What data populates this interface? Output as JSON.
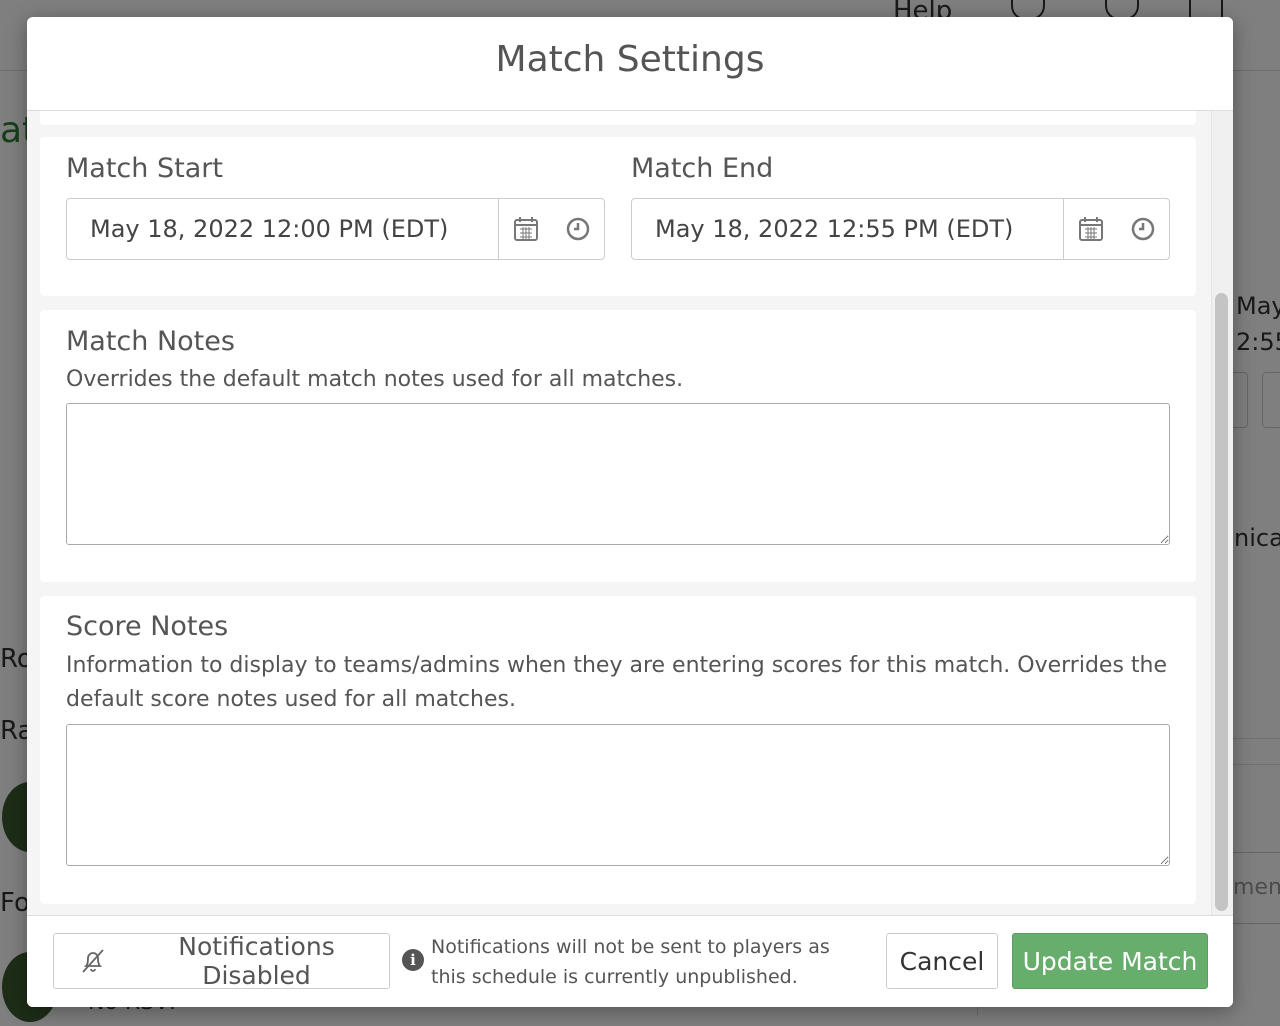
{
  "background": {
    "help_label": "Help",
    "heading_fragment": "at",
    "right_date_line1": "May",
    "right_date_line2": "2:55",
    "right_word": "nica",
    "right_input_placeholder": "men",
    "left_text_1": "Ro",
    "left_text_2": "Ra",
    "left_text_3": "Fox",
    "rsvp_text": "No RSVP"
  },
  "modal": {
    "title": "Match Settings",
    "match_start": {
      "label": "Match Start",
      "value": "May 18, 2022 12:00 PM (EDT)"
    },
    "match_end": {
      "label": "Match End",
      "value": "May 18, 2022 12:55 PM (EDT)"
    },
    "match_notes": {
      "label": "Match Notes",
      "help": "Overrides the default match notes used for all matches.",
      "value": ""
    },
    "score_notes": {
      "label": "Score Notes",
      "help": "Information to display to teams/admins when they are entering scores for this match. Overrides the default score notes used for all matches.",
      "value": ""
    }
  },
  "footer": {
    "notifications_button": "Notifications Disabled",
    "notice": "Notifications will not be sent to players as this schedule is currently unpublished.",
    "cancel_button": "Cancel",
    "update_button": "Update Match"
  },
  "colors": {
    "primary_green": "#67ad6b",
    "overlay": "rgba(0,0,0,0.5)"
  },
  "icons": [
    "calendar-icon",
    "clock-icon",
    "bell-slash-icon",
    "info-icon"
  ]
}
